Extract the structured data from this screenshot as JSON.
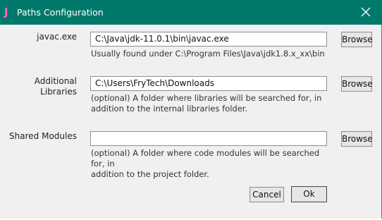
{
  "window": {
    "title": "Paths Configuration",
    "app_icon_glyph": "J",
    "close_icon": "close-icon",
    "title_bar_color": "#00796b",
    "app_icon_color": "#ff66cc"
  },
  "fields": {
    "javac": {
      "label": "javac.exe",
      "value": "C:\\Java\\jdk-11.0.1\\bin\\javac.exe",
      "hint_line1": "Usually found under C:\\Program Files\\Java\\jdk1.8.x_xx\\bin",
      "browse_label": "Browse"
    },
    "libraries": {
      "label": "Additional Libraries",
      "value": "C:\\Users\\FryTech\\Downloads",
      "hint_line1": "(optional) A folder where libraries will be searched for, in",
      "hint_line2": "addition to the internal libraries folder.",
      "browse_label": "Browse"
    },
    "modules": {
      "label": "Shared Modules",
      "value": "",
      "hint_line1": "(optional) A folder where code modules will be searched for, in",
      "hint_line2": "addition to the project folder.",
      "browse_label": "Browse"
    }
  },
  "actions": {
    "cancel_label": "Cancel",
    "ok_label": "Ok"
  }
}
